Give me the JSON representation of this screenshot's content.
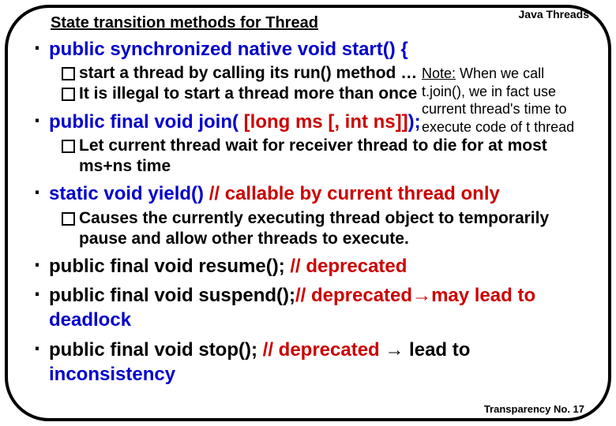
{
  "header": "Java Threads",
  "subtitle": "State transition methods for Thread",
  "items": [
    {
      "sig_pre": "public synchronized native void start() {",
      "subs": [
        "start a thread by calling its run() method …",
        "It is illegal to start a thread more than once"
      ]
    },
    {
      "sig_pre": "public final void join( ",
      "sig_red": "[long ms [, int ns]]",
      "sig_suf": ");",
      "subs": [
        "Let current thread wait for receiver thread to die for at most ms+ns time"
      ]
    },
    {
      "sig_pre": "static void  yield()   ",
      "sig_com": "// callable by current thread only",
      "subs": [
        "Causes the currently executing thread object to temporarily pause           and allow other threads to execute."
      ]
    },
    {
      "sig_pre": "public final void resume();  ",
      "sig_com": "// deprecated"
    },
    {
      "sig_pre": "public final void suspend();",
      "sig_com": "// deprecated",
      "arrow": true,
      "tail": "may lead to ",
      "deadlock": "deadlock"
    },
    {
      "sig_pre": "public final void stop();  ",
      "sig_com": "// deprecated ",
      "arrow2": "→",
      "tail2": " lead to ",
      "incon": "inconsistency"
    }
  ],
  "note": {
    "l0a": "Note:",
    "l0b": " When we call",
    "l1": "t.join(),  we in fact use",
    "l2": "current thread's time to",
    "l3": "execute code of t thread"
  },
  "footer": "Transparency No. 17"
}
